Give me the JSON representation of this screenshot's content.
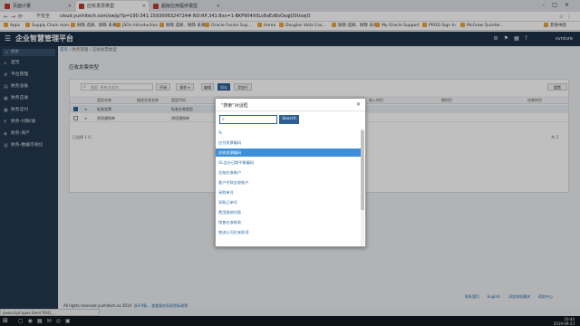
{
  "browser": {
    "tabs": [
      {
        "label": "页面计量"
      },
      {
        "label": "应收发票类型"
      },
      {
        "label": "超级应用程序模型"
      }
    ],
    "security_label": "不安全",
    "url": "cloud.yunhitech.com/sw/p/?p=100:341:1593006324724#:NO:RP,341:8xx=1-BKP904X0Ls6xEzBxOxqjO0UoxjO",
    "bookmarks": [
      "Apps",
      "Supply Chain man...",
      "财政 选择、财政 未来",
      "JSOn Introduction",
      "财政 选择、财政 未来",
      "Oracle Fusion Sup...",
      "Home",
      "Douglas Voltz Cos...",
      "财政 选择、财政 未来",
      "My Oracle Support",
      "PROD Sign In",
      "McGraw Quarter...",
      "其他书签"
    ],
    "status_url": "javascript:apex.item('P341_…"
  },
  "app": {
    "title": "企业智慧管理平台",
    "user": "vvnture"
  },
  "sidebar": {
    "search_placeholder": "搜索",
    "items": [
      {
        "label": "首页",
        "icon": "home-icon"
      },
      {
        "label": "平台管理",
        "icon": "settings-icon"
      },
      {
        "label": "财务总账",
        "icon": "book-icon"
      },
      {
        "label": "财务应收",
        "icon": "inbox-icon"
      },
      {
        "label": "财务应付",
        "icon": "outbox-icon"
      },
      {
        "label": "财务-付款/收",
        "icon": "money-icon"
      },
      {
        "label": "财务-资产",
        "icon": "asset-icon"
      },
      {
        "label": "财务-数据可视化",
        "icon": "chart-icon"
      }
    ]
  },
  "page": {
    "breadcrumb_home": "首页",
    "breadcrumb_rest": " / 财务管理 / 应收发票类型",
    "title": "应收发票类型",
    "toolbar": {
      "search_placeholder": "搜索: 所有文本列",
      "go": "开始",
      "actions": "操作 ▾",
      "edit": "编辑",
      "save": "保存",
      "add_row": "添加行",
      "reset": "重置"
    },
    "grid": {
      "headers": [
        "类型名称",
        "描述交易名称",
        "类型代码",
        "描述",
        "收入科目",
        "税科目",
        "应收科目"
      ],
      "rows": [
        {
          "cells": [
            "标准发票",
            "标准交易类型",
            "标准发票",
            "",
            "",
            "",
            ""
          ],
          "selected": true
        },
        {
          "cells": [
            "贷项通知单",
            "贷项通知单",
            "贷项通知单",
            "",
            "",
            "",
            ""
          ],
          "selected": false
        }
      ],
      "footer_left": "已选择 1 行",
      "footer_right": "共 2"
    }
  },
  "dialog": {
    "title": "\"搜索\"对话框",
    "search_value": "",
    "search_button": "Search",
    "items": [
      "%",
      "应付发票编码",
      "应收发票编码",
      "GL会计日期平衡编码",
      "总账应收帐户",
      "客户付款应收帐户",
      "采购单号",
      "采购订单号",
      "费用报销付款",
      "销售应收帐款",
      "物流公司往来款项"
    ],
    "selected_index": 2
  },
  "footer": {
    "links": [
      "联系我们",
      "English",
      "添加到收藏夹",
      "帮助中心"
    ],
    "copyright": "All rights reserved yunhitech.co 2014",
    "copyright_link": "浙ICP备... 查看服务条款隐私政策"
  },
  "taskbar": {
    "time": "10:44",
    "date": "2019-09-23"
  }
}
